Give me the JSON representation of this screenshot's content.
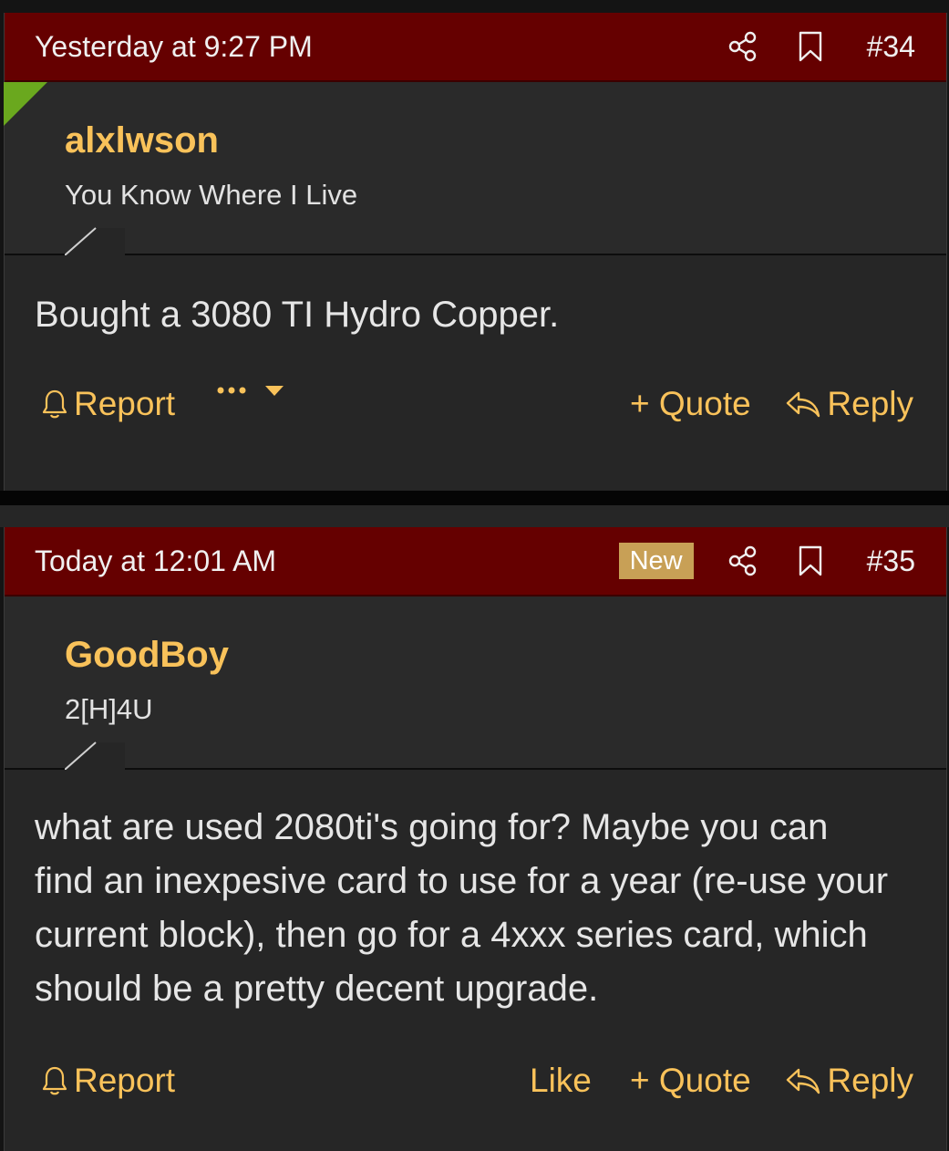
{
  "posts": [
    {
      "date": "Yesterday at 9:27 PM",
      "post_number": "#34",
      "username": "alxlwson",
      "user_title": "You Know Where I Live",
      "body": "Bought a 3080 TI Hydro Copper.",
      "actions": {
        "report": "Report",
        "quote": "+ Quote",
        "reply": "Reply"
      }
    },
    {
      "date": "Today at 12:01 AM",
      "new_badge": "New",
      "post_number": "#35",
      "username": "GoodBoy",
      "user_title": "2[H]4U",
      "body": "what are used 2080ti's going for? Maybe you can find an inexpesive card to use for a year (re-use your current block), then go for a 4xxx series card, which should be a pretty decent upgrade.",
      "actions": {
        "report": "Report",
        "like": "Like",
        "quote": "+ Quote",
        "reply": "Reply"
      }
    }
  ],
  "colors": {
    "header": "#650000",
    "accent": "#f9c25a",
    "badge": "#c8a056",
    "flag": "#6aa81e",
    "post_bg": "#262626"
  },
  "icons": [
    "share-icon",
    "bookmark-icon",
    "bell-icon",
    "ellipsis-icon",
    "caret-down-icon",
    "reply-arrow-icon"
  ]
}
